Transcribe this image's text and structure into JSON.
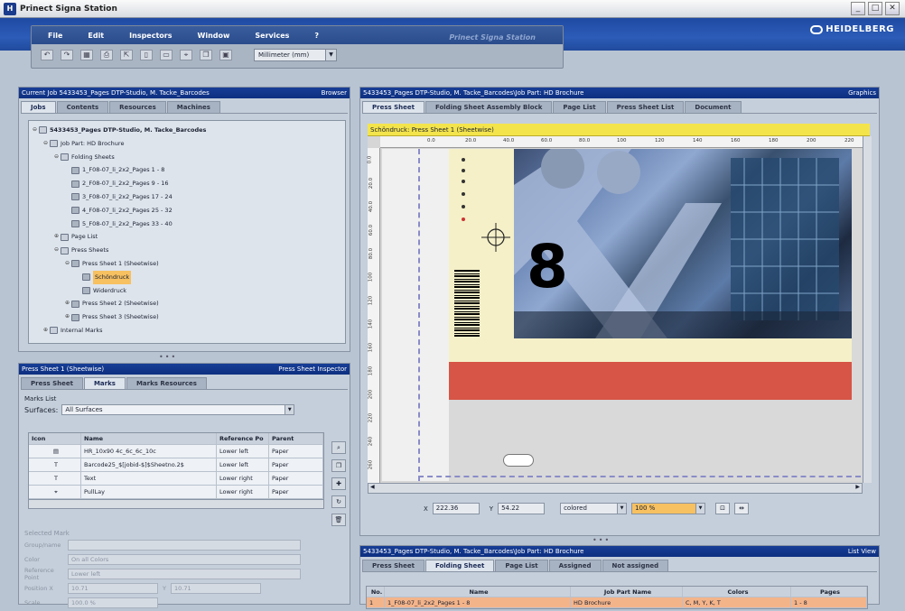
{
  "window": {
    "title": "Prinect Signa Station",
    "controls": [
      "_",
      "□",
      "✕"
    ]
  },
  "brand": {
    "logo": "HEIDELBERG"
  },
  "menu": {
    "items": [
      "File",
      "Edit",
      "Inspectors",
      "Window",
      "Services",
      "?"
    ],
    "ghost": "Prinect Signa Station"
  },
  "toolbar": {
    "icons": [
      "undo-icon",
      "redo-icon",
      "grid-icon",
      "print-icon",
      "export-icon",
      "page-icon",
      "sheet-icon",
      "mark-icon",
      "copy-icon",
      "paste-icon"
    ],
    "units": "Millimeter (mm)"
  },
  "jobs_panel": {
    "header": "Current Job 5433453_Pages DTP-Studio, M. Tacke_Barcodes",
    "header_right": "Browser",
    "tabs": [
      "Jobs",
      "Contents",
      "Resources",
      "Machines"
    ],
    "tree": [
      {
        "label": "5433453_Pages DTP-Studio, M. Tacke_Barcodes",
        "depth": 0,
        "toggle": "⊖",
        "bold": true
      },
      {
        "label": "Job Part: HD Brochure",
        "depth": 1,
        "toggle": "⊖"
      },
      {
        "label": "Folding Sheets",
        "depth": 2,
        "toggle": "⊖"
      },
      {
        "label": "1_F08-07_li_2x2_Pages 1 - 8",
        "depth": 3,
        "toggle": ""
      },
      {
        "label": "2_F08-07_li_2x2_Pages 9 - 16",
        "depth": 3,
        "toggle": ""
      },
      {
        "label": "3_F08-07_li_2x2_Pages 17 - 24",
        "depth": 3,
        "toggle": ""
      },
      {
        "label": "4_F08-07_li_2x2_Pages 25 - 32",
        "depth": 3,
        "toggle": ""
      },
      {
        "label": "5_F08-07_li_2x2_Pages 33 - 40",
        "depth": 3,
        "toggle": ""
      },
      {
        "label": "Page List",
        "depth": 2,
        "toggle": "⊕"
      },
      {
        "label": "Press Sheets",
        "depth": 2,
        "toggle": "⊖"
      },
      {
        "label": "Press Sheet 1 (Sheetwise)",
        "depth": 3,
        "toggle": "⊖"
      },
      {
        "label": "Schöndruck",
        "depth": 4,
        "toggle": "",
        "selected": true
      },
      {
        "label": "Widerdruck",
        "depth": 4,
        "toggle": ""
      },
      {
        "label": "Press Sheet 2 (Sheetwise)",
        "depth": 3,
        "toggle": "⊕"
      },
      {
        "label": "Press Sheet 3 (Sheetwise)",
        "depth": 3,
        "toggle": "⊕"
      },
      {
        "label": "Internal Marks",
        "depth": 1,
        "toggle": "⊕"
      }
    ]
  },
  "inspector": {
    "header": "Press Sheet 1 (Sheetwise)",
    "header_right": "Press Sheet Inspector",
    "tabs": [
      "Press Sheet",
      "Marks",
      "Marks Resources"
    ],
    "marks_list_label": "Marks List",
    "surfaces_label": "Surfaces:",
    "surfaces_value": "All Surfaces",
    "columns": [
      "Icon",
      "Name",
      "Reference Po",
      "Parent"
    ],
    "rows": [
      {
        "icon": "▤",
        "name": "HR_10x90 4c_6c_6c_10c",
        "ref": "Lower left",
        "parent": "Paper"
      },
      {
        "icon": "T",
        "name": "Barcode25_$[jobid-$]$Sheetno.2$",
        "ref": "Lower left",
        "parent": "Paper"
      },
      {
        "icon": "T",
        "name": "Text",
        "ref": "Lower right",
        "parent": "Paper"
      },
      {
        "icon": "⌖",
        "name": "PullLay",
        "ref": "Lower right",
        "parent": "Paper"
      }
    ],
    "selected_mark_label": "Selected Mark",
    "fields": [
      {
        "label": "Group/name",
        "value": ""
      },
      {
        "label": "Color",
        "value": "On all Colors"
      },
      {
        "label": "Reference Point",
        "value": "Lower left"
      },
      {
        "label": "Position X",
        "value": "10.71"
      },
      {
        "label": "Scale",
        "value": "100.0 %"
      }
    ],
    "pos_y_label": "Y",
    "pos_y_value": "10.71"
  },
  "graphics": {
    "header": "5433453_Pages DTP-Studio, M. Tacke_Barcodes\\Job Part: HD Brochure",
    "header_right": "Graphics",
    "tabs": [
      "Press Sheet",
      "Folding Sheet Assembly Block",
      "Page List",
      "Press Sheet List",
      "Document"
    ],
    "strip": "Schöndruck: Press Sheet 1 (Sheetwise)",
    "hticks": [
      "0.0",
      "20.0",
      "40.0",
      "60.0",
      "80.0",
      "100",
      "120",
      "140",
      "160",
      "180",
      "200",
      "220"
    ],
    "vticks": [
      "0.0",
      "20.0",
      "40.0",
      "60.0",
      "80.0",
      "100",
      "120",
      "140",
      "160",
      "180",
      "200",
      "220",
      "240",
      "260"
    ],
    "big_number": "8",
    "x_label": "X",
    "x_value": "222.36",
    "y_label": "Y",
    "y_value": "54.22",
    "color_mode": "colored",
    "zoom": "100 %"
  },
  "listview": {
    "header": "5433453_Pages DTP-Studio, M. Tacke_Barcodes\\Job Part: HD Brochure",
    "header_right": "List View",
    "tabs": [
      "Press Sheet",
      "Folding Sheet",
      "Page List",
      "Assigned",
      "Not assigned"
    ],
    "columns": [
      "No.",
      "Name",
      "Job Part Name",
      "Colors",
      "Pages"
    ],
    "rows": [
      {
        "no": "1",
        "name": "1_F08-07_li_2x2_Pages 1 - 8",
        "jobpart": "HD Brochure",
        "colors": "C, M, Y, K, T",
        "pages": "1 - 8"
      }
    ]
  }
}
